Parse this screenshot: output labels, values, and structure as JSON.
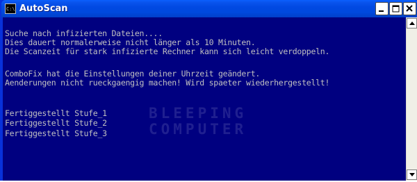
{
  "window": {
    "title": "AutoScan",
    "icon": "console-icon",
    "controls": [
      "minimize-icon",
      "maximize-icon",
      "close-icon"
    ]
  },
  "console": {
    "background": "#000080",
    "text_color": "#c0c0c0",
    "lines": [
      "Suche nach infizierten Dateien....",
      "Dies dauert normalerweise nicht länger als 10 Minuten.",
      "Die Scanzeit für stark infizierte Rechner kann sich leicht verdoppeln.",
      "",
      "ComboFix hat die Einstellungen deiner Uhrzeit geändert.",
      "Aenderungen nicht rueckgaengig machen! Wird spaeter wiederhergestellt!",
      "",
      "",
      "Fertiggestellt Stufe_1",
      "Fertiggestellt Stufe_2",
      "Fertiggestellt Stufe_3"
    ]
  },
  "watermark": {
    "line1": "BLEEPING",
    "line2": "COMPUTER"
  },
  "scrollbar": {
    "up_icon": "arrow-up-icon",
    "down_icon": "arrow-down-icon"
  }
}
